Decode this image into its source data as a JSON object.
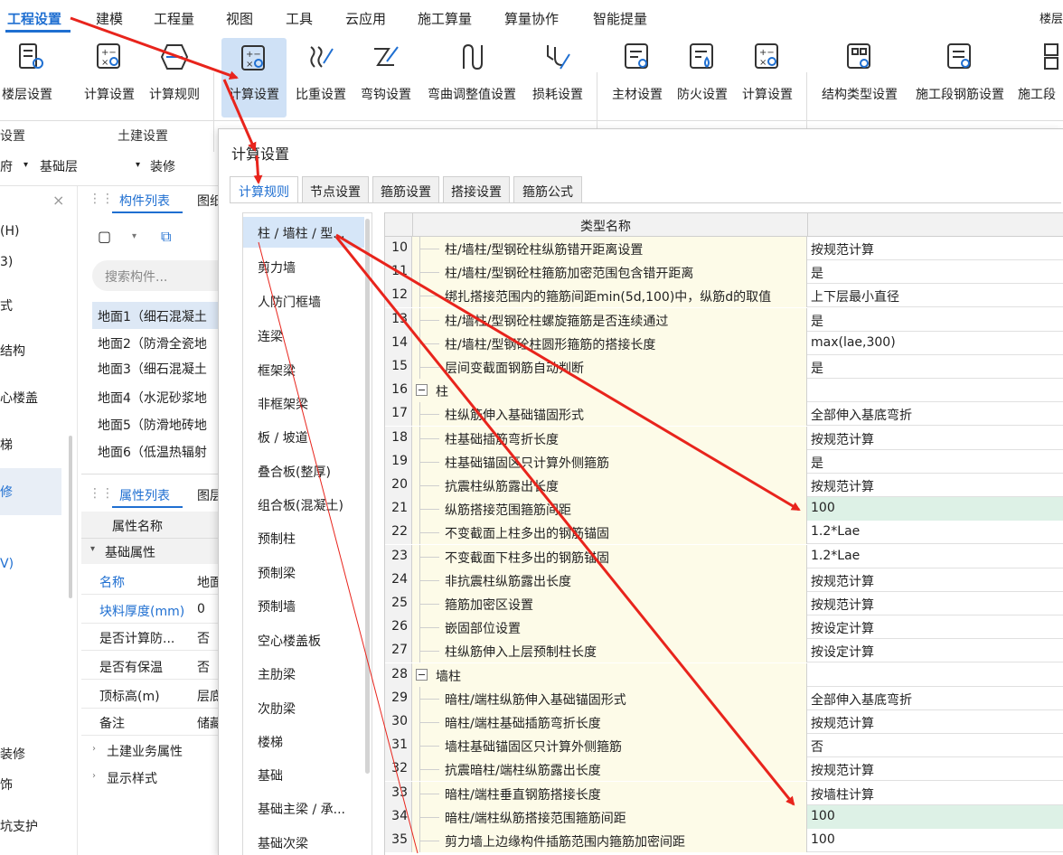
{
  "menubar": {
    "items": [
      "工程设置",
      "建模",
      "工程量",
      "视图",
      "工具",
      "云应用",
      "施工算量",
      "算量协作",
      "智能提量"
    ],
    "right_clip": "楼层"
  },
  "ribbon": {
    "buttons": [
      "楼层设置",
      "计算设置",
      "计算规则",
      "计算设置",
      "比重设置",
      "弯钩设置",
      "弯曲调整值设置",
      "损耗设置",
      "主材设置",
      "防火设置",
      "计算设置",
      "结构类型设置",
      "施工段钢筋设置",
      "施工段"
    ],
    "group_labels": [
      "设置",
      "土建设置"
    ]
  },
  "toolbar2": {
    "left_text": "府",
    "floor": "基础层",
    "type": "装修"
  },
  "panel_a": {
    "items": [
      "(H)",
      "3)",
      "式",
      "结构",
      "心楼盖",
      "梯",
      "修",
      "V)",
      "装修",
      "饰",
      "坑支护"
    ]
  },
  "component_panel": {
    "tab_list": "构件列表",
    "tab_other": "图纸",
    "search_placeholder": "搜索构件...",
    "items": [
      "地面1（细石混凝土",
      "地面2（防滑全瓷地",
      "地面3（细石混凝土",
      "地面4（水泥砂浆地",
      "地面5（防滑地砖地",
      "地面6（低温热辐射"
    ]
  },
  "property_panel": {
    "tab_props": "属性列表",
    "tab_other": "图层",
    "header": "属性名称",
    "section": "基础属性",
    "rows": [
      {
        "k": "名称",
        "v": "地面"
      },
      {
        "k": "块料厚度(mm)",
        "v": "0"
      },
      {
        "k": "是否计算防...",
        "v": "否"
      },
      {
        "k": "是否有保温",
        "v": "否"
      },
      {
        "k": "顶标高(m)",
        "v": "层底"
      },
      {
        "k": "备注",
        "v": "储藏"
      }
    ],
    "groups": [
      "土建业务属性",
      "显示样式"
    ]
  },
  "dialog": {
    "title": "计算设置",
    "tabs": [
      "计算规则",
      "节点设置",
      "箍筋设置",
      "搭接设置",
      "箍筋公式"
    ],
    "categories": [
      "柱 / 墙柱 / 型...",
      "剪力墙",
      "人防门框墙",
      "连梁",
      "框架梁",
      "非框架梁",
      "板 / 坡道",
      "叠合板(整厚)",
      "组合板(混凝土)",
      "预制柱",
      "预制梁",
      "预制墙",
      "空心楼盖板",
      "主肋梁",
      "次肋梁",
      "楼梯",
      "基础",
      "基础主梁 / 承...",
      "基础次梁"
    ],
    "grid_header": "类型名称",
    "rows": [
      {
        "n": "10",
        "name": "柱/墙柱/型钢砼柱纵筋错开距离设置",
        "val": "按规范计算"
      },
      {
        "n": "11",
        "name": "柱/墙柱/型钢砼柱箍筋加密范围包含错开距离",
        "val": "是"
      },
      {
        "n": "12",
        "name": "绑扎搭接范围内的箍筋间距min(5d,100)中，纵筋d的取值",
        "val": "上下层最小直径"
      },
      {
        "n": "13",
        "name": "柱/墙柱/型钢砼柱螺旋箍筋是否连续通过",
        "val": "是"
      },
      {
        "n": "14",
        "name": "柱/墙柱/型钢砼柱圆形箍筋的搭接长度",
        "val": "max(lae,300)"
      },
      {
        "n": "15",
        "name": "层间变截面钢筋自动判断",
        "val": "是"
      },
      {
        "n": "16",
        "name": "柱",
        "val": "",
        "group": true
      },
      {
        "n": "17",
        "name": "柱纵筋伸入基础锚固形式",
        "val": "全部伸入基底弯折"
      },
      {
        "n": "18",
        "name": "柱基础插筋弯折长度",
        "val": "按规范计算"
      },
      {
        "n": "19",
        "name": "柱基础锚固区只计算外侧箍筋",
        "val": "是"
      },
      {
        "n": "20",
        "name": "抗震柱纵筋露出长度",
        "val": "按规范计算"
      },
      {
        "n": "21",
        "name": "纵筋搭接范围箍筋间距",
        "val": "100",
        "hl": true
      },
      {
        "n": "22",
        "name": "不变截面上柱多出的钢筋锚固",
        "val": "1.2*Lae"
      },
      {
        "n": "23",
        "name": "不变截面下柱多出的钢筋锚固",
        "val": "1.2*Lae"
      },
      {
        "n": "24",
        "name": "非抗震柱纵筋露出长度",
        "val": "按规范计算"
      },
      {
        "n": "25",
        "name": "箍筋加密区设置",
        "val": "按规范计算"
      },
      {
        "n": "26",
        "name": "嵌固部位设置",
        "val": "按设定计算"
      },
      {
        "n": "27",
        "name": "柱纵筋伸入上层预制柱长度",
        "val": "按设定计算"
      },
      {
        "n": "28",
        "name": "墙柱",
        "val": "",
        "group": true
      },
      {
        "n": "29",
        "name": "暗柱/端柱纵筋伸入基础锚固形式",
        "val": "全部伸入基底弯折"
      },
      {
        "n": "30",
        "name": "暗柱/端柱基础插筋弯折长度",
        "val": "按规范计算"
      },
      {
        "n": "31",
        "name": "墙柱基础锚固区只计算外侧箍筋",
        "val": "否"
      },
      {
        "n": "32",
        "name": "抗震暗柱/端柱纵筋露出长度",
        "val": "按规范计算"
      },
      {
        "n": "33",
        "name": "暗柱/端柱垂直钢筋搭接长度",
        "val": "按墙柱计算"
      },
      {
        "n": "34",
        "name": "暗柱/端柱纵筋搭接范围箍筋间距",
        "val": "100",
        "hl": true
      },
      {
        "n": "35",
        "name": "剪力墙上边缘构件插筋范围内箍筋加密间距",
        "val": "100"
      }
    ]
  },
  "colors": {
    "accent": "#1f6fd1",
    "arrow": "#e8241c",
    "highlight": "#ddf1e6",
    "name_bg": "#fdfbe8"
  }
}
